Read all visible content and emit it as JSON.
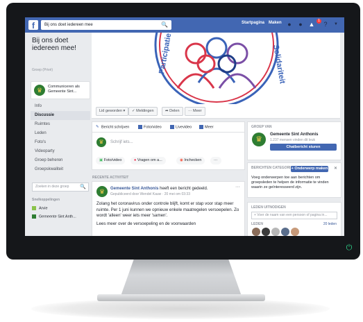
{
  "topbar": {
    "logo": "f",
    "search_value": "Bij ons doet iedereen mee",
    "links": [
      "Startpagina",
      "Maken"
    ],
    "notification_count": "1"
  },
  "group": {
    "title": "Bij ons doet iedereen mee!",
    "privacy": "Groep (Privé)",
    "acting_as": "Communiceren als Gemeente Sint...",
    "menu": [
      "Info",
      "Discussie",
      "Ruimtes",
      "Leden",
      "Foto's",
      "Videoparty",
      "Groep beheren",
      "Groepskwaliteit"
    ],
    "active_menu": "Discussie",
    "search_placeholder": "Zoeken in deze groep",
    "shortcuts_title": "Snelkoppelingen",
    "shortcuts": [
      {
        "label": "Arvie",
        "count": ""
      },
      {
        "label": "Gemeente Sint Anth...",
        "count": ""
      }
    ]
  },
  "cover": {
    "left_word": "Participatie",
    "right_word": "Solidariteit",
    "colors": {
      "blue": "#3a63b8",
      "red": "#d9364a",
      "purple": "#7b4fa6",
      "navy": "#1f3d87"
    }
  },
  "actions": [
    "Lid geworden",
    "Meldingen",
    "Delen",
    "Meer"
  ],
  "composer": {
    "tabs": [
      "Bericht schrijven",
      "Foto/video",
      "Livevideo",
      "Meer"
    ],
    "placeholder": "Schrijf iets...",
    "pills": [
      "Foto/video",
      "Vragen om a...",
      "Inchecken",
      "···"
    ]
  },
  "recent_label": "RECENTE ACTIVITEIT",
  "post": {
    "author": "Gemeente Sint Anthonis",
    "action": "heeft een bericht gedeeld.",
    "meta": "Gepubliceerd door Wendel Kauw · 20 mei om 03:33",
    "body_1": "Zolang het coronavirus onder controle blijft, komt er stap voor stap meer ruimte. Per 1 juni kunnen we opnieuw enkele maatregelen versoepelen. Zo wordt 'alleen' weer iets meer 'samen'.",
    "body_2": "Lees meer over de versoepeling en de voorwaarden"
  },
  "right": {
    "owner_title": "GROEP VAN",
    "owner_name": "Gemeente Sint Anthonis",
    "owner_likes": "1.237 mensen vinden dit leuk",
    "chat_button": "Chatbericht sturen",
    "topics_title": "BERICHTEN CATEGORISEREN",
    "topics_button": "+ Onderwerp maken",
    "topics_desc": "Voeg onderwerpen toe aan berichten om groepsleden te helpen de informatie te vinden waarin ze geïnteresseerd zijn.",
    "invite_title": "LEDEN UITNODIGEN",
    "invite_placeholder": "+ Voer de naam van een persoon of pagina in...",
    "members_label": "LEDEN",
    "members_count": "20 leden"
  }
}
